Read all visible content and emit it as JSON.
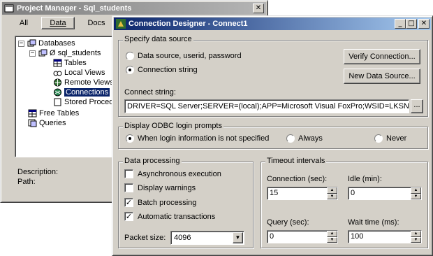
{
  "project_manager": {
    "title": "Project Manager - Sql_students",
    "close_glyph": "✕",
    "tabs": [
      "All",
      "Data",
      "Docs"
    ],
    "tree": {
      "databases": "Databases",
      "db_name": "Ø sql_students",
      "tables": "Tables",
      "local_views": "Local Views",
      "remote_views": "Remote Views",
      "connections": "Connections",
      "stored_procedures": "Stored Proced",
      "free_tables": "Free Tables",
      "queries": "Queries"
    },
    "description_label": "Description:",
    "path_label": "Path:"
  },
  "designer": {
    "title": "Connection Designer - Connect1",
    "minimize_glyph": "_",
    "maximize_glyph": "□",
    "close_glyph": "✕",
    "data_source": {
      "group_label": "Specify data source",
      "option_dsn": "Data source, userid, password",
      "option_connstring": "Connection string",
      "verify_button": "Verify Connection...",
      "new_source_button": "New Data Source...",
      "connect_string_label": "Connect string:",
      "connect_string_value": "DRIVER=SQL Server;SERVER=(local);APP=Microsoft Visual FoxPro;WSID=LKSN;LANG",
      "browse_button": "..."
    },
    "odbc": {
      "group_label": "Display ODBC login prompts",
      "option_when": "When login information is not specified",
      "option_always": "Always",
      "option_never": "Never"
    },
    "processing": {
      "group_label": "Data processing",
      "async": "Asynchronous execution",
      "warnings": "Display warnings",
      "batch": "Batch processing",
      "automatic": "Automatic transactions",
      "checked_glyph": "✓",
      "packet_label": "Packet size:",
      "packet_value": "4096",
      "dropdown_glyph": "▼"
    },
    "timeout": {
      "group_label": "Timeout intervals",
      "connection_label": "Connection (sec):",
      "connection_value": "15",
      "idle_label": "Idle (min):",
      "idle_value": "0",
      "query_label": "Query (sec):",
      "query_value": "0",
      "wait_label": "Wait time (ms):",
      "wait_value": "100",
      "spin_up": "▲",
      "spin_down": "▼"
    }
  }
}
